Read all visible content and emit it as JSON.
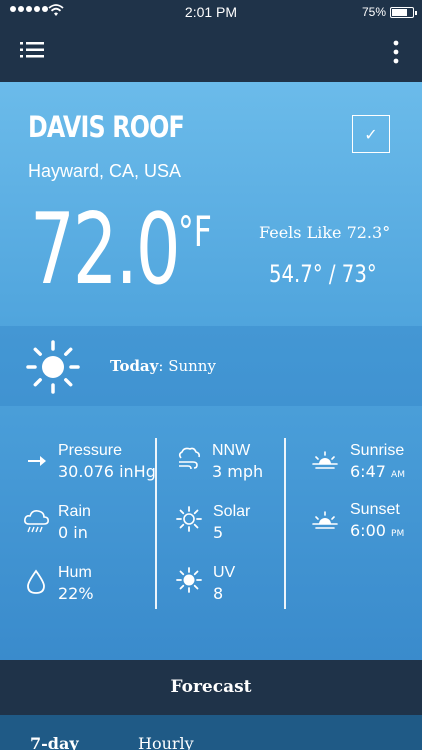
{
  "status_bar": {
    "time": "2:01 PM",
    "battery": "75%",
    "battery_level": 0.75
  },
  "nav": {
    "menu_icon": "list-menu-icon",
    "more_icon": "vertical-dots-icon"
  },
  "station": {
    "name": "DAVIS ROOF",
    "location": "Hayward, CA, USA",
    "checkmark": "✓"
  },
  "current": {
    "temp": "72.0",
    "unit": "°F",
    "feels_like": "Feels Like 72.3°",
    "hi_lo": "54.7° / 73°"
  },
  "condition": {
    "day_label": "Today",
    "sep": ": ",
    "text": "Sunny",
    "icon": "sun-icon"
  },
  "stats": {
    "pressure": {
      "label": "Pressure",
      "value": "30.076 inHg",
      "icon": "arrow-right-icon"
    },
    "rain": {
      "label": "Rain",
      "value": "0 in",
      "icon": "rain-cloud-icon"
    },
    "hum": {
      "label": "Hum",
      "value": "22%",
      "icon": "droplet-icon"
    },
    "wind": {
      "label": "NNW",
      "value": "3 mph",
      "icon": "wind-cloud-icon"
    },
    "solar": {
      "label": "Solar",
      "value": "5",
      "icon": "solar-sun-icon"
    },
    "uv": {
      "label": "UV",
      "value": "8",
      "icon": "uv-sun-icon"
    },
    "sunrise": {
      "label": "Sunrise",
      "value": "6:47",
      "suffix": "AM",
      "icon": "sunrise-icon"
    },
    "sunset": {
      "label": "Sunset",
      "value": "6:00",
      "suffix": "PM",
      "icon": "sunset-icon"
    }
  },
  "forecast": {
    "title": "Forecast",
    "tabs": [
      "7-day",
      "Hourly"
    ]
  },
  "colors": {
    "nav": "#1f3349",
    "panel_top": "#6bbbea",
    "panel_bottom": "#3a8bcc",
    "tab_bar": "#1f5a86"
  }
}
